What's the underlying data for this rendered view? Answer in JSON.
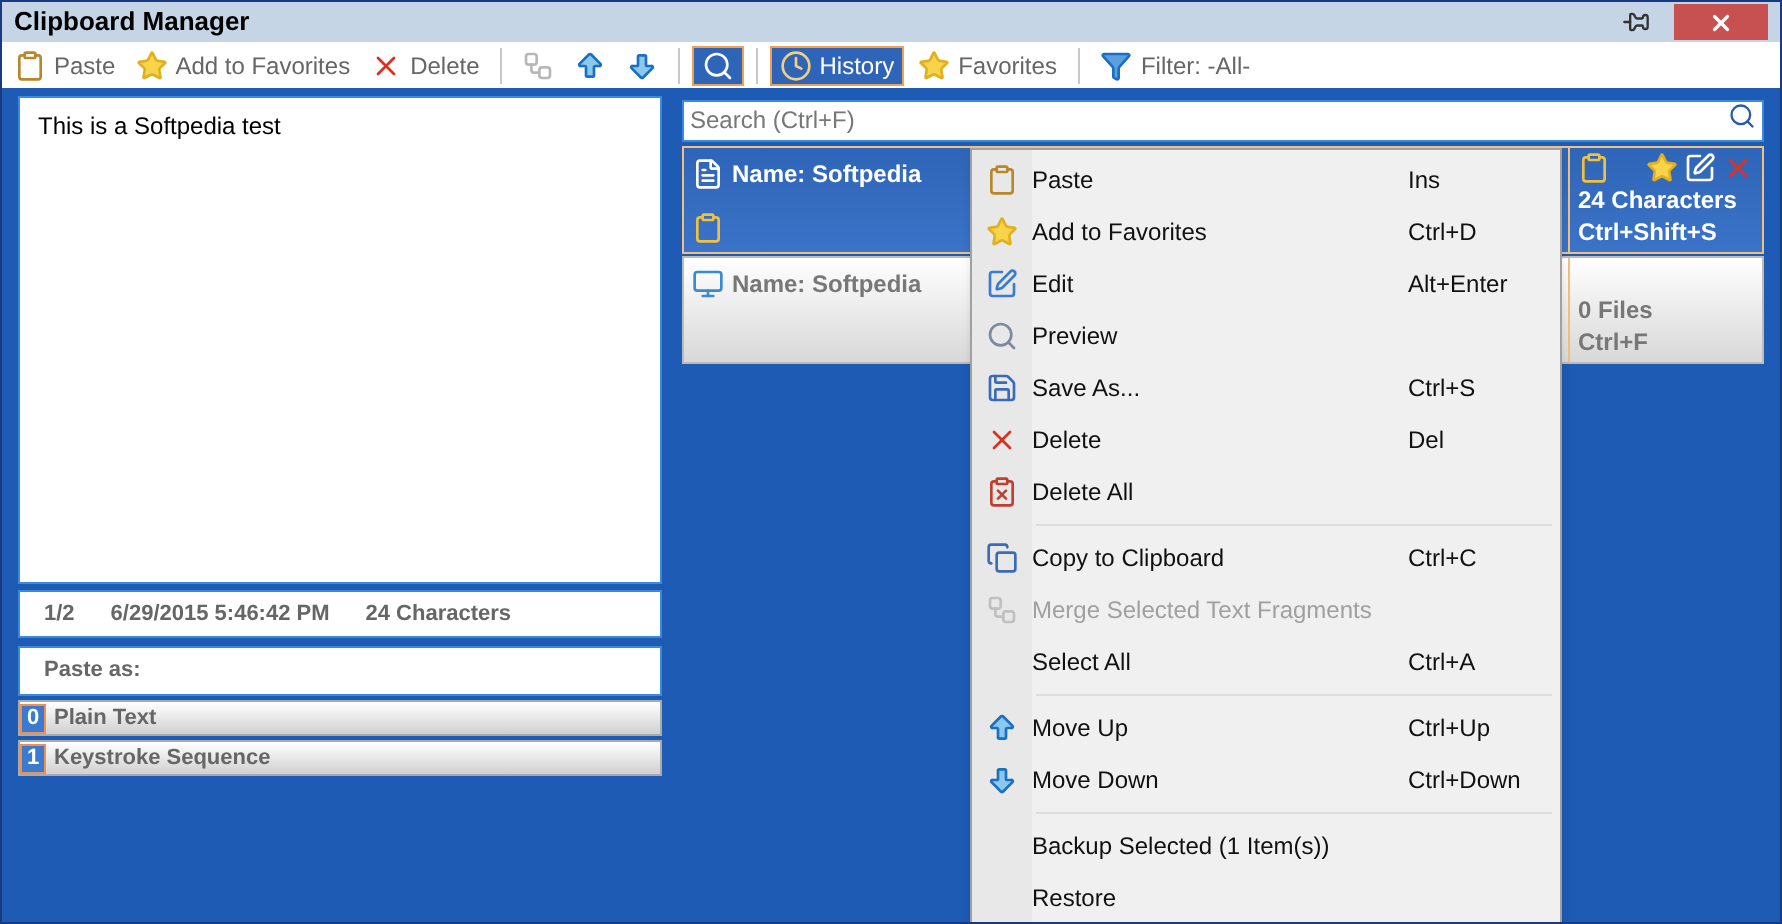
{
  "window": {
    "title": "Clipboard Manager"
  },
  "toolbar": [
    {
      "kind": "button",
      "label": "Paste"
    },
    {
      "kind": "button",
      "label": "Add to Favorites"
    },
    {
      "kind": "button",
      "label": "Delete"
    },
    {
      "kind": "separator"
    },
    {
      "kind": "icon",
      "disabled": true
    },
    {
      "kind": "icon",
      "disabled": false
    },
    {
      "kind": "icon",
      "disabled": false
    },
    {
      "kind": "separator"
    },
    {
      "kind": "toggle",
      "selected": true
    },
    {
      "kind": "separator"
    },
    {
      "kind": "tab",
      "label": "History",
      "selected": true
    },
    {
      "kind": "tab",
      "label": "Favorites",
      "selected": false
    },
    {
      "kind": "separator"
    },
    {
      "kind": "filter",
      "label": "Filter: -All-"
    }
  ],
  "preview": {
    "text": "This is a Softpedia test"
  },
  "info": {
    "position": "1/2",
    "date": "6/29/2015 5:46:42 PM",
    "size": "24 Characters"
  },
  "paste_as": {
    "label": "Paste as:",
    "options": [
      {
        "key": "0",
        "label": "Plain Text"
      },
      {
        "key": "1",
        "label": "Keystroke Sequence"
      }
    ]
  },
  "search": {
    "placeholder": "Search (Ctrl+F)"
  },
  "clips": [
    {
      "name": "Name: Softpedia",
      "selected": true,
      "size": "24 Characters",
      "shortcut": "Ctrl+Shift+S"
    },
    {
      "name": "Name: Softpedia",
      "selected": false,
      "size": "0 Files",
      "shortcut": "Ctrl+F"
    }
  ],
  "context_menu": [
    {
      "kind": "item",
      "label": "Paste",
      "shortcut": "Ins",
      "disabled": false
    },
    {
      "kind": "item",
      "label": "Add to Favorites",
      "shortcut": "Ctrl+D",
      "disabled": false
    },
    {
      "kind": "item",
      "label": "Edit",
      "shortcut": "Alt+Enter",
      "disabled": false
    },
    {
      "kind": "item",
      "label": "Preview",
      "disabled": false
    },
    {
      "kind": "item",
      "label": "Save As...",
      "shortcut": "Ctrl+S",
      "disabled": false
    },
    {
      "kind": "item",
      "label": "Delete",
      "shortcut": "Del",
      "disabled": false
    },
    {
      "kind": "item",
      "label": "Delete All",
      "disabled": false
    },
    {
      "kind": "separator"
    },
    {
      "kind": "item",
      "label": "Copy to Clipboard",
      "shortcut": "Ctrl+C",
      "disabled": false
    },
    {
      "kind": "item",
      "label": "Merge Selected Text Fragments",
      "disabled": true
    },
    {
      "kind": "item",
      "label": "Select All",
      "shortcut": "Ctrl+A",
      "disabled": false
    },
    {
      "kind": "separator"
    },
    {
      "kind": "item",
      "label": "Move Up",
      "shortcut": "Ctrl+Up",
      "disabled": false
    },
    {
      "kind": "item",
      "label": "Move Down",
      "shortcut": "Ctrl+Down",
      "disabled": false
    },
    {
      "kind": "separator"
    },
    {
      "kind": "item",
      "label": "Backup Selected (1 Item(s))",
      "disabled": false
    },
    {
      "kind": "item",
      "label": "Restore",
      "disabled": false
    }
  ]
}
